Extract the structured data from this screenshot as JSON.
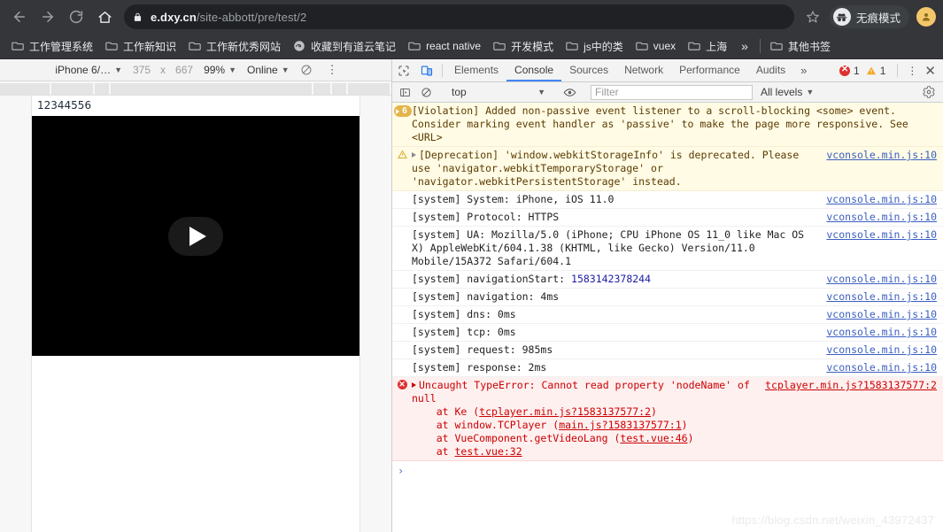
{
  "browser": {
    "nav": {
      "back": "back-arrow",
      "forward": "forward-arrow",
      "reload": "reload",
      "home": "home"
    },
    "omnibox": {
      "lock_icon": "lock-icon",
      "host": "e.dxy.cn",
      "path": "/site-abbott/pre/test/2",
      "full_url": "e.dxy.cn/site-abbott/pre/test/2"
    },
    "star_icon": "star-outline-icon",
    "incognito_label": "无痕模式",
    "incognito_icon": "incognito-hat-glasses-icon",
    "profile_icon": "profile-avatar",
    "bookmarks": [
      {
        "label": "工作管理系统",
        "icon": "folder-icon"
      },
      {
        "label": "工作新知识",
        "icon": "folder-icon"
      },
      {
        "label": "工作新优秀网站",
        "icon": "folder-icon"
      },
      {
        "label": "收藏到有道云笔记",
        "icon": "youdao-cloud-icon"
      },
      {
        "label": "react native",
        "icon": "folder-icon"
      },
      {
        "label": "开发模式",
        "icon": "folder-icon"
      },
      {
        "label": "js中的类",
        "icon": "folder-icon"
      },
      {
        "label": "vuex",
        "icon": "folder-icon"
      },
      {
        "label": "上海",
        "icon": "folder-icon"
      }
    ],
    "bookmarks_overflow": "»",
    "other_bookmarks": {
      "label": "其他书签",
      "icon": "folder-icon"
    }
  },
  "device_toolbar": {
    "device_name": "iPhone 6/…",
    "width": "375",
    "times": "x",
    "height": "667",
    "zoom": "99%",
    "network": "Online",
    "throttle_icon": "no-throttling-icon",
    "more_icon": "kebab-menu-icon"
  },
  "page": {
    "title_text": "12344556",
    "video": {
      "play_icon": "play-button-icon"
    }
  },
  "devtools": {
    "inspect_icon": "inspect-element-icon",
    "device_toolbar_icon": "toggle-device-toolbar-icon",
    "tabs": [
      {
        "label": "Elements",
        "selected": false
      },
      {
        "label": "Console",
        "selected": true
      },
      {
        "label": "Sources",
        "selected": false
      },
      {
        "label": "Network",
        "selected": false
      },
      {
        "label": "Performance",
        "selected": false
      },
      {
        "label": "Audits",
        "selected": false
      }
    ],
    "tabs_overflow": "»",
    "error_count": "1",
    "warning_count": "1",
    "kebab_icon": "kebab-menu-icon",
    "close_icon": "close-icon",
    "console_toolbar": {
      "sidebar_icon": "console-sidebar-icon",
      "clear_icon": "clear-console-icon",
      "context": "top",
      "eye_icon": "live-expression-icon",
      "filter_placeholder": "Filter",
      "filter_value": "",
      "levels": "All levels",
      "settings_icon": "gear-icon"
    },
    "messages": [
      {
        "kind": "warning",
        "gutter": "group-badge",
        "badge_count": "6",
        "text": "[Violation] Added non-passive event listener to a scroll-blocking <some> event. Consider marking event handler as 'passive' to make the page more responsive. See <URL>",
        "source": ""
      },
      {
        "kind": "warning",
        "gutter": "warning-icon",
        "disclosure": true,
        "text": "[Deprecation] 'window.webkitStorageInfo' is deprecated. Please use 'navigator.webkitTemporaryStorage' or 'navigator.webkitPersistentStorage' instead.",
        "source": "vconsole.min.js:10"
      },
      {
        "kind": "info",
        "text": "[system] System: iPhone, iOS 11.0",
        "source": "vconsole.min.js:10"
      },
      {
        "kind": "info",
        "text": "[system] Protocol: HTTPS",
        "source": "vconsole.min.js:10"
      },
      {
        "kind": "info",
        "text": "[system] UA: Mozilla/5.0 (iPhone; CPU iPhone OS 11_0 like Mac OS X) AppleWebKit/604.1.38 (KHTML, like Gecko) Version/11.0 Mobile/15A372 Safari/604.1",
        "source": "vconsole.min.js:10"
      },
      {
        "kind": "info",
        "text_prefix": "[system] navigationStart: ",
        "number": "1583142378244",
        "source": "vconsole.min.js:10"
      },
      {
        "kind": "info",
        "text": "[system] navigation: 4ms",
        "source": "vconsole.min.js:10"
      },
      {
        "kind": "info",
        "text": "[system] dns: 0ms",
        "source": "vconsole.min.js:10"
      },
      {
        "kind": "info",
        "text": "[system] tcp: 0ms",
        "source": "vconsole.min.js:10"
      },
      {
        "kind": "info",
        "text": "[system] request: 985ms",
        "source": "vconsole.min.js:10"
      },
      {
        "kind": "info",
        "text": "[system] response: 2ms",
        "source": "vconsole.min.js:10"
      }
    ],
    "error": {
      "gutter": "error-icon",
      "headline": "Uncaught TypeError: Cannot read property 'nodeName' of null",
      "source": "tcplayer.min.js?1583137577:2",
      "stack": [
        {
          "prefix": "    at Ke (",
          "link": "tcplayer.min.js?1583137577:2",
          "suffix": ")"
        },
        {
          "prefix": "    at window.TCPlayer (",
          "link": "main.js?1583137577:1",
          "suffix": ")"
        },
        {
          "prefix": "    at VueComponent.getVideoLang (",
          "link": "test.vue:46",
          "suffix": ")"
        },
        {
          "prefix": "    at ",
          "link": "test.vue:32",
          "suffix": ""
        }
      ]
    },
    "prompt_caret": "›"
  },
  "watermark": "https://blog.csdn.net/weixin_43972437",
  "colors": {
    "chrome_bg": "#35363a",
    "omnibox_bg": "#202124",
    "accent_blue": "#4285f4",
    "warning_bg": "#fffbe5",
    "error_bg": "#fff0f0",
    "error_red": "#df3030",
    "warning_amber": "#f5a623"
  }
}
